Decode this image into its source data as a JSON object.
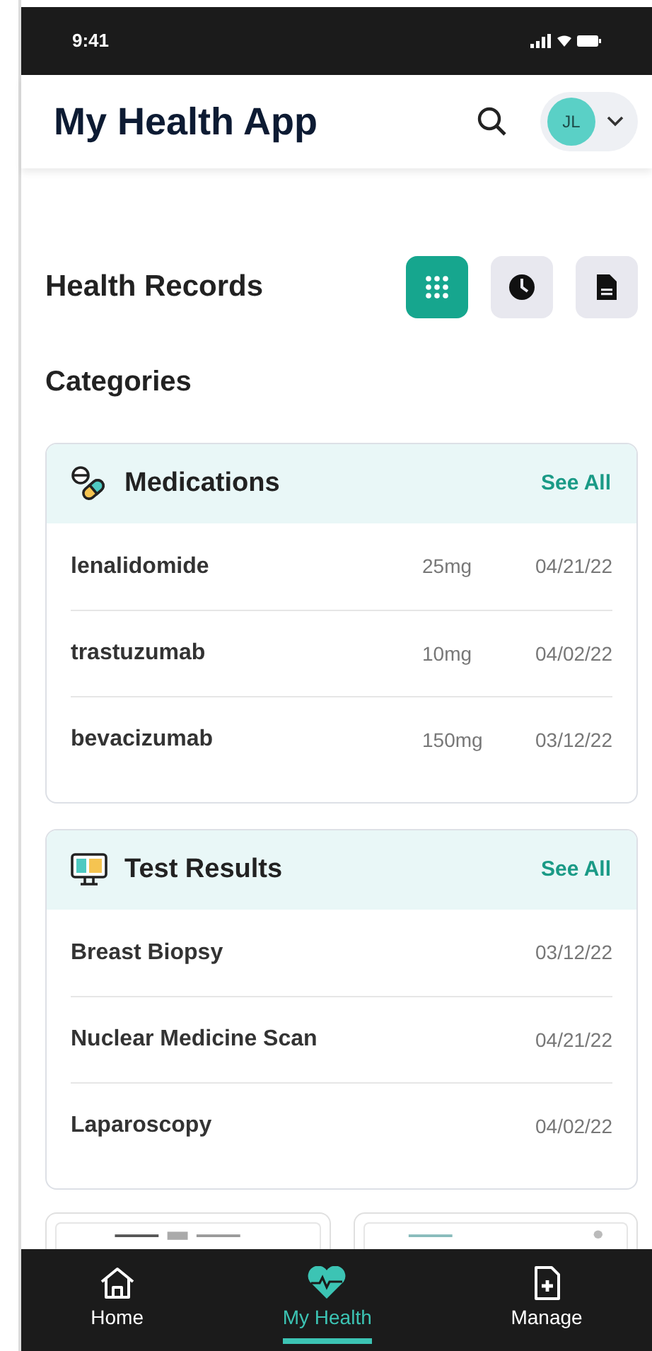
{
  "status_bar": {
    "time": "9:41"
  },
  "header": {
    "title": "My Health App",
    "avatar": "JL"
  },
  "section": {
    "title": "Health Records",
    "views": [
      {
        "kind": "grid",
        "selected": true
      },
      {
        "kind": "clock",
        "selected": false
      },
      {
        "kind": "document",
        "selected": false
      }
    ]
  },
  "categories_title": "Categories",
  "categories": [
    {
      "kind": "medications",
      "title": "Medications",
      "link": "See All",
      "rows": [
        {
          "name": "lenalidomide",
          "dose": "25mg",
          "date": "04/21/22"
        },
        {
          "name": "trastuzumab",
          "dose": "10mg",
          "date": "04/02/22"
        },
        {
          "name": "bevacizumab",
          "dose": "150mg",
          "date": "03/12/22"
        }
      ]
    },
    {
      "kind": "tests",
      "title": "Test Results",
      "link": "See All",
      "rows": [
        {
          "name": "Breast Biopsy",
          "date": "03/12/22"
        },
        {
          "name": "Nuclear Medicine Scan",
          "date": "04/21/22"
        },
        {
          "name": "Laparoscopy",
          "date": "04/02/22"
        }
      ]
    }
  ],
  "nav": [
    {
      "kind": "home",
      "label": "Home",
      "selected": false
    },
    {
      "kind": "health",
      "label": "My Health",
      "selected": true
    },
    {
      "kind": "manage",
      "label": "Manage",
      "selected": false
    }
  ]
}
